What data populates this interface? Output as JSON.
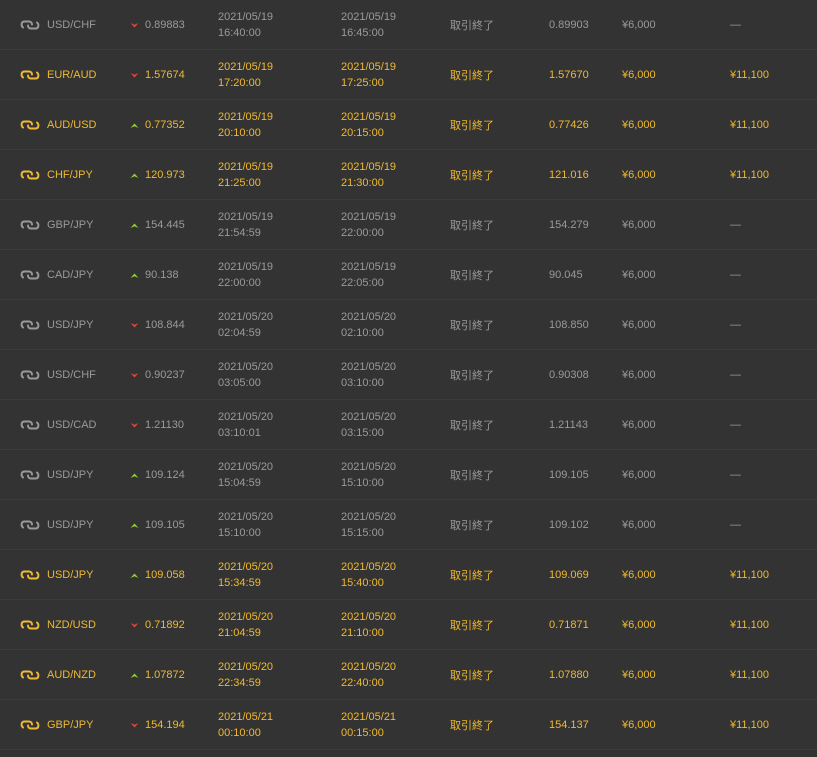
{
  "colors": {
    "background": "#333333",
    "win_text": "#f0b92f",
    "normal_text": "#9a9a9a",
    "high_arrow": "#9acd3c",
    "low_arrow": "#e0483a"
  },
  "icons": {
    "pair": "currency-pair-icon",
    "high": "high-arrow-icon",
    "low": "low-arrow-icon"
  },
  "trades": [
    {
      "pair": "USD/CHF",
      "direction": "low",
      "entry_rate": "0.89883",
      "open_date": "2021/05/19",
      "open_time": "16:40:00",
      "close_date": "2021/05/19",
      "close_time": "16:45:00",
      "status": "取引終了",
      "end_rate": "0.89903",
      "amount": "¥6,000",
      "payout": "—",
      "result": "loss"
    },
    {
      "pair": "EUR/AUD",
      "direction": "low",
      "entry_rate": "1.57674",
      "open_date": "2021/05/19",
      "open_time": "17:20:00",
      "close_date": "2021/05/19",
      "close_time": "17:25:00",
      "status": "取引終了",
      "end_rate": "1.57670",
      "amount": "¥6,000",
      "payout": "¥11,100",
      "result": "win"
    },
    {
      "pair": "AUD/USD",
      "direction": "high",
      "entry_rate": "0.77352",
      "open_date": "2021/05/19",
      "open_time": "20:10:00",
      "close_date": "2021/05/19",
      "close_time": "20:15:00",
      "status": "取引終了",
      "end_rate": "0.77426",
      "amount": "¥6,000",
      "payout": "¥11,100",
      "result": "win"
    },
    {
      "pair": "CHF/JPY",
      "direction": "high",
      "entry_rate": "120.973",
      "open_date": "2021/05/19",
      "open_time": "21:25:00",
      "close_date": "2021/05/19",
      "close_time": "21:30:00",
      "status": "取引終了",
      "end_rate": "121.016",
      "amount": "¥6,000",
      "payout": "¥11,100",
      "result": "win"
    },
    {
      "pair": "GBP/JPY",
      "direction": "high",
      "entry_rate": "154.445",
      "open_date": "2021/05/19",
      "open_time": "21:54:59",
      "close_date": "2021/05/19",
      "close_time": "22:00:00",
      "status": "取引終了",
      "end_rate": "154.279",
      "amount": "¥6,000",
      "payout": "—",
      "result": "loss"
    },
    {
      "pair": "CAD/JPY",
      "direction": "high",
      "entry_rate": "90.138",
      "open_date": "2021/05/19",
      "open_time": "22:00:00",
      "close_date": "2021/05/19",
      "close_time": "22:05:00",
      "status": "取引終了",
      "end_rate": "90.045",
      "amount": "¥6,000",
      "payout": "—",
      "result": "loss"
    },
    {
      "pair": "USD/JPY",
      "direction": "low",
      "entry_rate": "108.844",
      "open_date": "2021/05/20",
      "open_time": "02:04:59",
      "close_date": "2021/05/20",
      "close_time": "02:10:00",
      "status": "取引終了",
      "end_rate": "108.850",
      "amount": "¥6,000",
      "payout": "—",
      "result": "loss"
    },
    {
      "pair": "USD/CHF",
      "direction": "low",
      "entry_rate": "0.90237",
      "open_date": "2021/05/20",
      "open_time": "03:05:00",
      "close_date": "2021/05/20",
      "close_time": "03:10:00",
      "status": "取引終了",
      "end_rate": "0.90308",
      "amount": "¥6,000",
      "payout": "—",
      "result": "loss"
    },
    {
      "pair": "USD/CAD",
      "direction": "low",
      "entry_rate": "1.21130",
      "open_date": "2021/05/20",
      "open_time": "03:10:01",
      "close_date": "2021/05/20",
      "close_time": "03:15:00",
      "status": "取引終了",
      "end_rate": "1.21143",
      "amount": "¥6,000",
      "payout": "—",
      "result": "loss"
    },
    {
      "pair": "USD/JPY",
      "direction": "high",
      "entry_rate": "109.124",
      "open_date": "2021/05/20",
      "open_time": "15:04:59",
      "close_date": "2021/05/20",
      "close_time": "15:10:00",
      "status": "取引終了",
      "end_rate": "109.105",
      "amount": "¥6,000",
      "payout": "—",
      "result": "loss"
    },
    {
      "pair": "USD/JPY",
      "direction": "high",
      "entry_rate": "109.105",
      "open_date": "2021/05/20",
      "open_time": "15:10:00",
      "close_date": "2021/05/20",
      "close_time": "15:15:00",
      "status": "取引終了",
      "end_rate": "109.102",
      "amount": "¥6,000",
      "payout": "—",
      "result": "loss"
    },
    {
      "pair": "USD/JPY",
      "direction": "high",
      "entry_rate": "109.058",
      "open_date": "2021/05/20",
      "open_time": "15:34:59",
      "close_date": "2021/05/20",
      "close_time": "15:40:00",
      "status": "取引終了",
      "end_rate": "109.069",
      "amount": "¥6,000",
      "payout": "¥11,100",
      "result": "win"
    },
    {
      "pair": "NZD/USD",
      "direction": "low",
      "entry_rate": "0.71892",
      "open_date": "2021/05/20",
      "open_time": "21:04:59",
      "close_date": "2021/05/20",
      "close_time": "21:10:00",
      "status": "取引終了",
      "end_rate": "0.71871",
      "amount": "¥6,000",
      "payout": "¥11,100",
      "result": "win"
    },
    {
      "pair": "AUD/NZD",
      "direction": "high",
      "entry_rate": "1.07872",
      "open_date": "2021/05/20",
      "open_time": "22:34:59",
      "close_date": "2021/05/20",
      "close_time": "22:40:00",
      "status": "取引終了",
      "end_rate": "1.07880",
      "amount": "¥6,000",
      "payout": "¥11,100",
      "result": "win"
    },
    {
      "pair": "GBP/JPY",
      "direction": "low",
      "entry_rate": "154.194",
      "open_date": "2021/05/21",
      "open_time": "00:10:00",
      "close_date": "2021/05/21",
      "close_time": "00:15:00",
      "status": "取引終了",
      "end_rate": "154.137",
      "amount": "¥6,000",
      "payout": "¥11,100",
      "result": "win"
    }
  ]
}
